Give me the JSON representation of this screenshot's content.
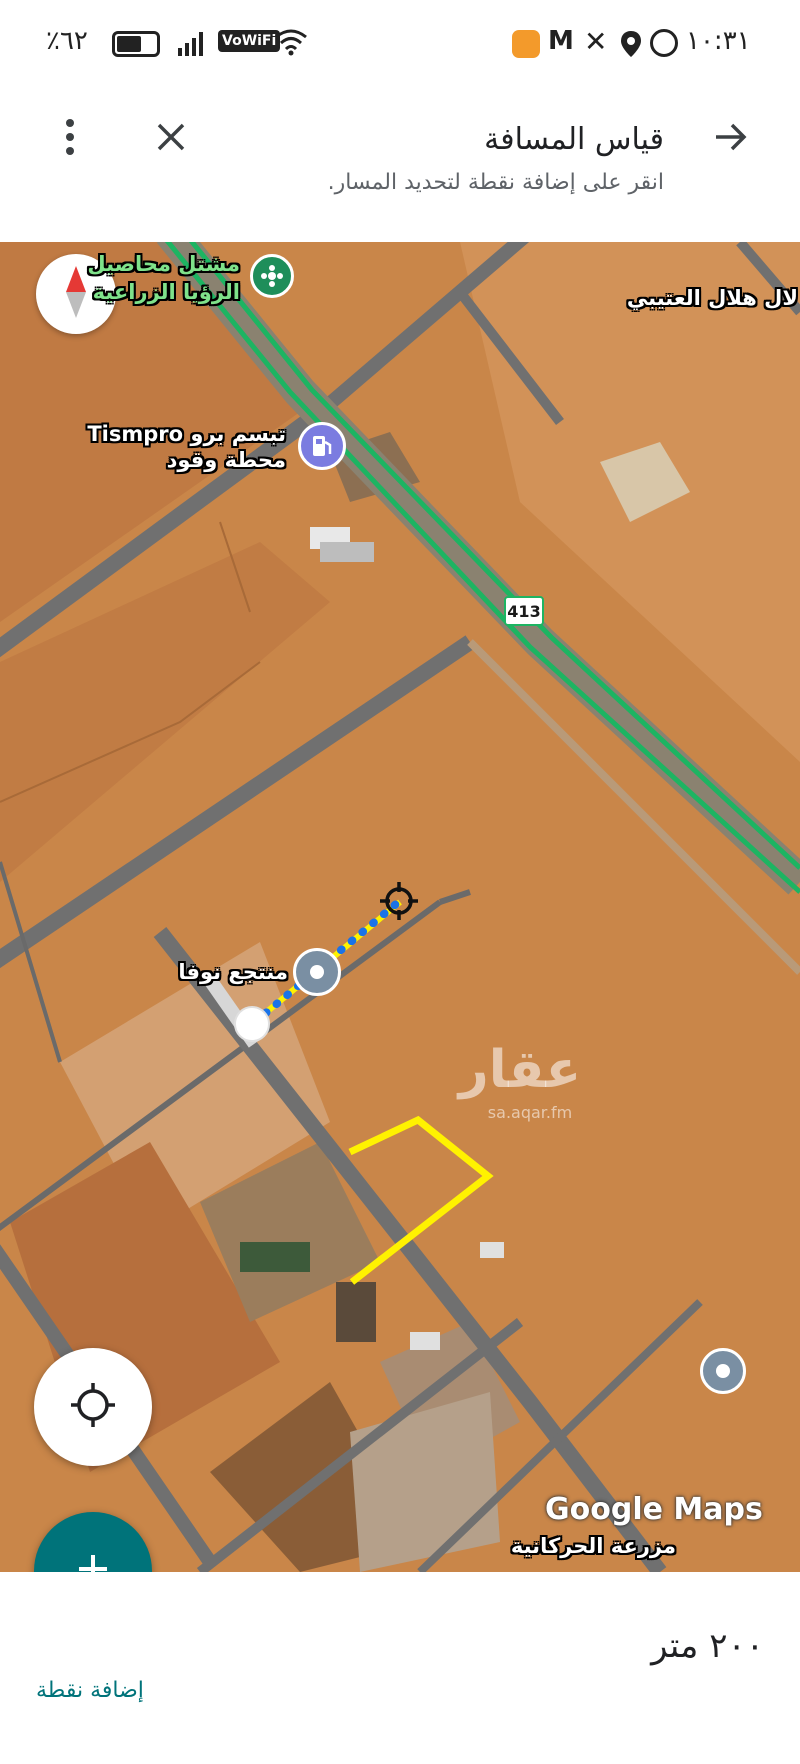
{
  "status_bar": {
    "time": "١٠:٣١",
    "battery": "٪٦٢",
    "network": "VoWiFi"
  },
  "toolbar": {
    "title": "قياس المسافة",
    "subtitle": "انقر على إضافة نقطة لتحديد المسار."
  },
  "map": {
    "labels": {
      "nursery": "مشتل محاصيل",
      "nursery_line2": "الرؤيا الزراعية",
      "hilal": "لال هلال العتيبي",
      "station_name": "تبسم برو Tismpro",
      "station_type": "محطة وقود",
      "route": "413",
      "resort": "منتجع نوفا",
      "farm": "مزرعة الحركانية",
      "watermark": "عقار",
      "watermark_url": "sa.aqar.fm",
      "google_logo": "Google Maps"
    },
    "colors": {
      "desert": "#c9854a",
      "road": "#6d6d6d",
      "highway_green": "#1db462",
      "measure_line": "#fff200",
      "measure_dots": "#1a73e8"
    }
  },
  "bottom": {
    "distance": "٢٠٠ متر",
    "add_point_label": "إضافة نقطة"
  },
  "icons": {
    "back": "arrow-right-icon",
    "close": "close-icon",
    "menu": "more-vert-icon",
    "compass": "compass-icon",
    "locate": "my-location-icon",
    "add": "plus-icon"
  }
}
